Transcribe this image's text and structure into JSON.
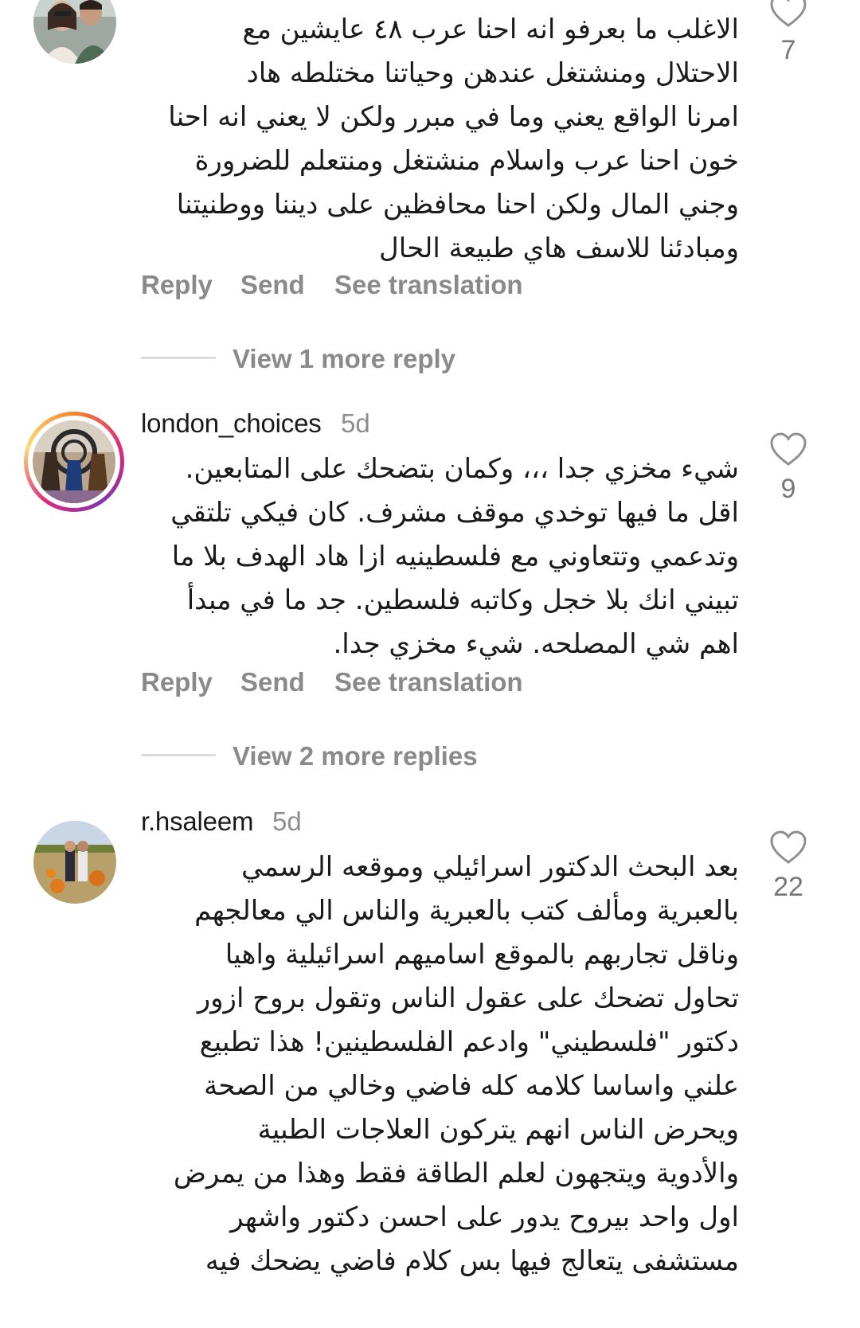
{
  "comments": [
    {
      "username": "",
      "time": "",
      "text": "الاغلب ما بعرفو انه احنا عرب ٤٨ عايشين مع\nالاحتلال ومنشتغل عندهن وحياتنا مختلطه هاد\nامرنا الواقع يعني وما في مبرر ولكن لا يعني انه احنا\nخون احنا عرب واسلام منشتغل ومنتعلم للضرورة\nوجني المال ولكن احنا محافظين على ديننا ووطنيتنا\nومبادئنا للاسف هاي طبيعة الحال",
      "likes": "7",
      "actions": {
        "reply": "Reply",
        "send": "Send",
        "translate": "See translation"
      },
      "more_replies": "View 1 more reply"
    },
    {
      "username": "london_choices",
      "time": "5d",
      "text": "شيء مخزي جدا ،،، وكمان بتضحك على المتابعين.\nاقل ما فيها توخدي موقف مشرف. كان فيكي تلتقي\nوتدعمي وتتعاوني مع فلسطينيه ازا هاد الهدف بلا ما\nتبيني انك بلا خجل وكاتبه فلسطين. جد ما في مبدأ\nاهم شي المصلحه. شيء مخزي جدا.",
      "likes": "9",
      "actions": {
        "reply": "Reply",
        "send": "Send",
        "translate": "See translation"
      },
      "more_replies": "View 2 more replies"
    },
    {
      "username": "r.hsaleem",
      "time": "5d",
      "text": "بعد البحث الدكتور اسرائيلي وموقعه الرسمي\nبالعبرية ومألف كتب بالعبرية والناس الي معالجهم\nوناقل تجاربهم بالموقع اساميهم اسرائيلية واهيا\nتحاول تضحك على عقول الناس وتقول بروح ازور\nدكتور \"فلسطيني\" وادعم الفلسطينين! هذا تطبيع\nعلني واساسا كلامه كله فاضي وخالي من الصحة\nويحرض الناس انهم يتركون العلاجات الطبية\nوالأدوية ويتجهون لعلم الطاقة فقط وهذا من يمرض\nاول واحد بيروح يدور على احسن دكتور واشهر\nمستشفى يتعالج فيها بس كلام فاضي يضحك فيه",
      "likes": "22"
    }
  ],
  "icons": {
    "like": "heart-outline-icon"
  },
  "colors": {
    "secondary_text": "#8a8a8a",
    "story_ring": "#dd2a7b"
  }
}
